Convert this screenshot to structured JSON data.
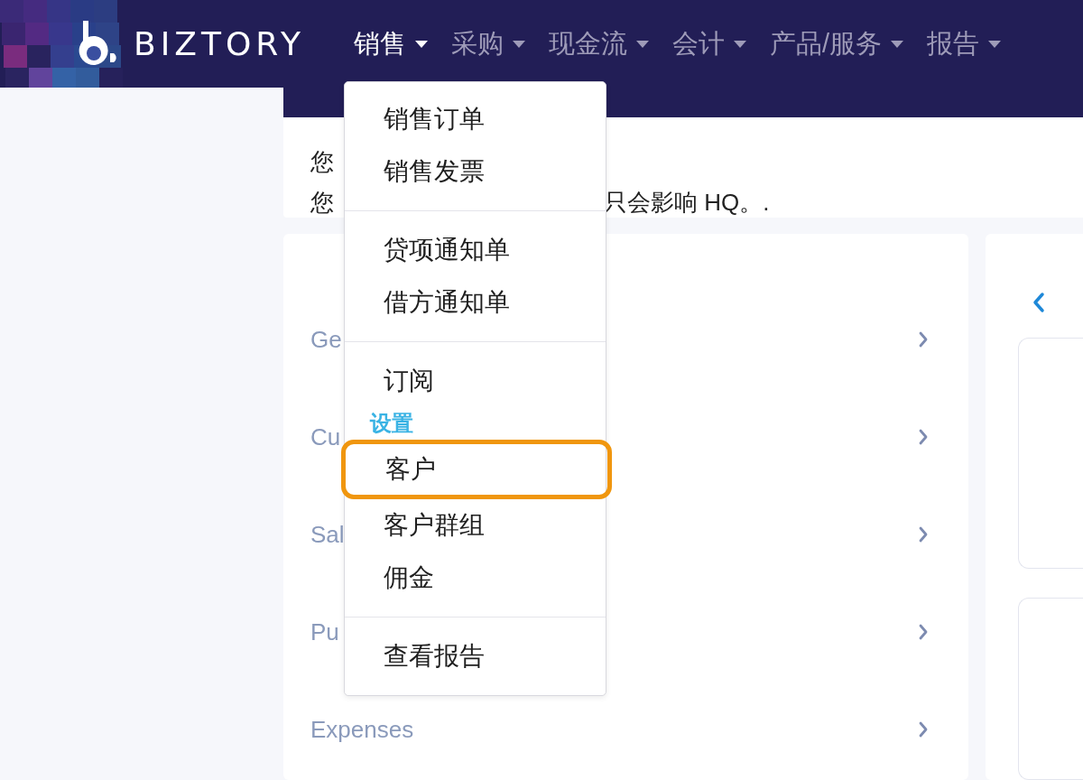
{
  "nav": {
    "brand": "BIZTORY",
    "items": [
      {
        "label": "销售",
        "selected": true
      },
      {
        "label": "采购",
        "selected": false
      },
      {
        "label": "现金流",
        "selected": false
      },
      {
        "label": "会计",
        "selected": false
      },
      {
        "label": "产品/服务",
        "selected": false
      },
      {
        "label": "报告",
        "selected": false
      }
    ]
  },
  "notice": {
    "lines": [
      [
        {
          "text": "您"
        }
      ],
      [
        {
          "text": "您"
        },
        {
          "text": "只会影响 HQ。."
        }
      ]
    ]
  },
  "settings_list": {
    "rows": [
      {
        "label": "Ge"
      },
      {
        "label": "Cu"
      },
      {
        "label": "Sal"
      },
      {
        "label": "Pu"
      },
      {
        "label": "Expenses"
      }
    ]
  },
  "dropdown": {
    "groups": [
      {
        "items": [
          {
            "kind": "item",
            "label": "销售订单",
            "highlighted": false
          },
          {
            "kind": "item",
            "label": "销售发票",
            "highlighted": false
          }
        ]
      },
      {
        "items": [
          {
            "kind": "item",
            "label": "贷项通知单",
            "highlighted": false
          },
          {
            "kind": "item",
            "label": "借方通知单",
            "highlighted": false
          }
        ]
      },
      {
        "items": [
          {
            "kind": "item",
            "label": "订阅",
            "highlighted": false
          },
          {
            "kind": "heading",
            "label": "设置"
          },
          {
            "kind": "item",
            "label": "客户",
            "highlighted": true
          },
          {
            "kind": "item",
            "label": "客户群组",
            "highlighted": false
          },
          {
            "kind": "item",
            "label": "佣金",
            "highlighted": false
          }
        ]
      },
      {
        "items": [
          {
            "kind": "item",
            "label": "查看报告",
            "highlighted": false
          }
        ]
      }
    ]
  }
}
